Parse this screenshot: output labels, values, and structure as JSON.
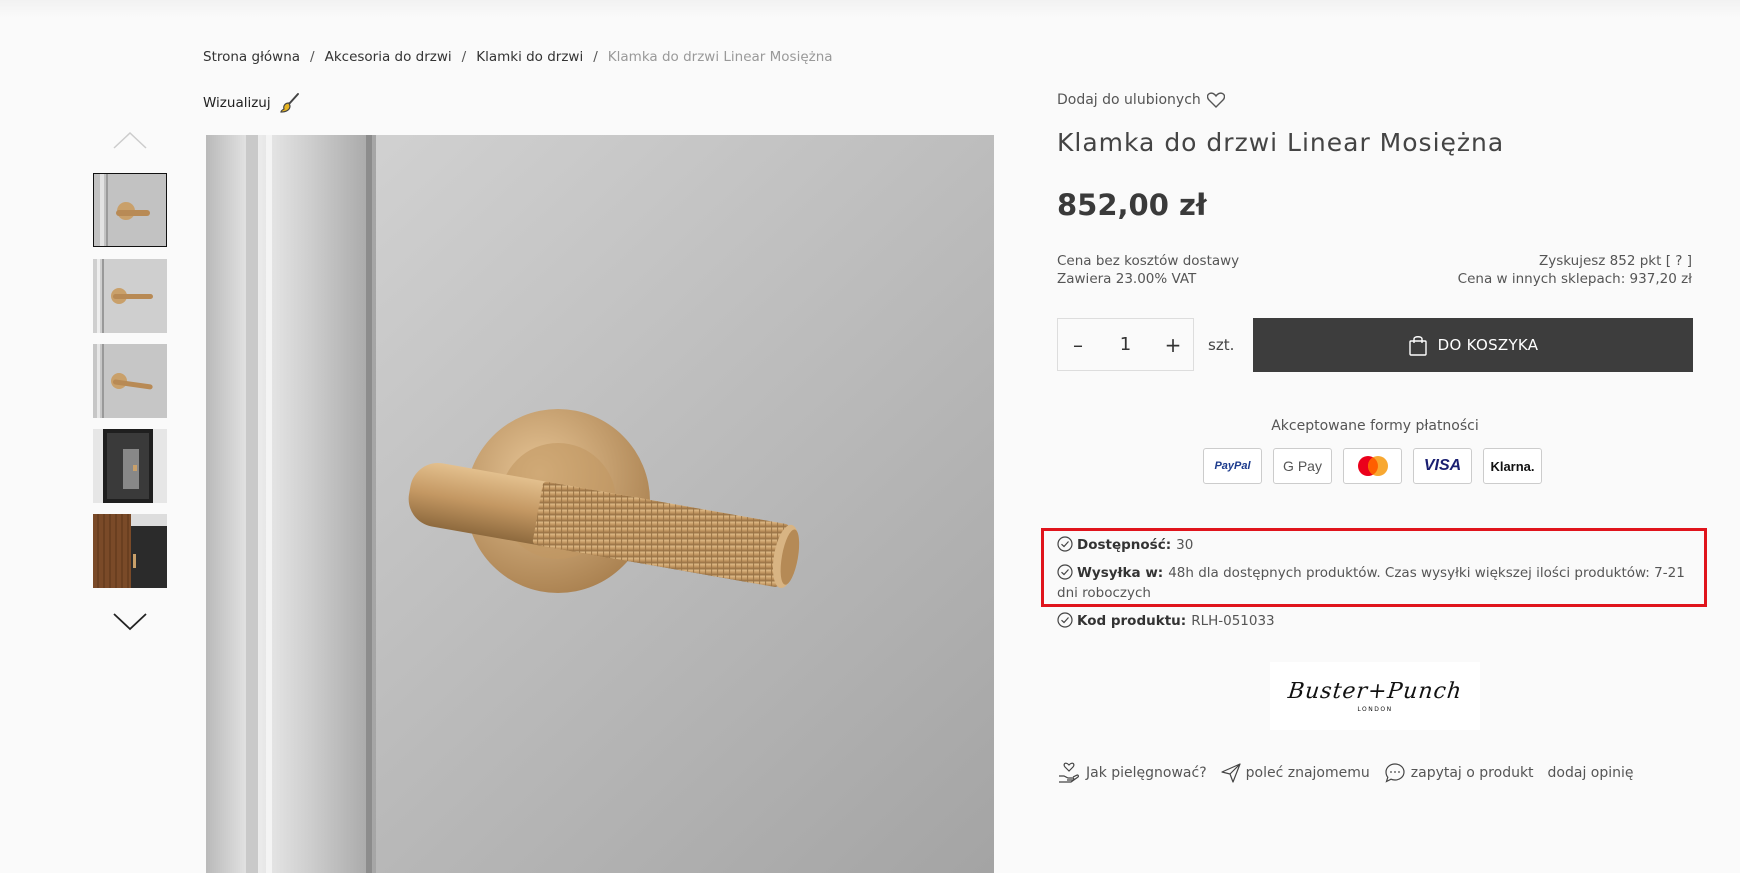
{
  "breadcrumb": {
    "items": [
      "Strona główna",
      "Akcesoria do drzwi",
      "Klamki do drzwi"
    ],
    "separator": "/",
    "current": "Klamka do drzwi Linear Mosiężna"
  },
  "visualize": {
    "label": "Wizualizuj",
    "icon": "paintbrush-icon"
  },
  "gallery": {
    "up_icon": "chevron-up-icon",
    "down_icon": "chevron-down-icon",
    "thumb_count": 5,
    "active_index": 0
  },
  "product": {
    "favorites_label": "Dodaj do ulubionych",
    "title": "Klamka do drzwi Linear Mosiężna",
    "price": "852,00 zł",
    "shipping_note": "Cena bez kosztów dostawy",
    "vat_note": "Zawiera 23.00% VAT",
    "points_label": "Zyskujesz 852 pkt",
    "points_help": "[ ? ]",
    "other_price_label": "Cena w innych sklepach:",
    "other_price_value": "937,20 zł"
  },
  "cart": {
    "minus": "–",
    "quantity": "1",
    "plus": "+",
    "unit": "szt.",
    "button_label": "DO KOSZYKA"
  },
  "payments": {
    "title": "Akceptowane formy płatności",
    "paypal": "PayPal",
    "googlepay": "G Pay",
    "visa": "VISA",
    "klarna": "Klarna."
  },
  "availability": {
    "label": "Dostępność:",
    "value": "30"
  },
  "shipping": {
    "label": "Wysyłka w:",
    "value": "48h dla dostępnych produktów. Czas wysyłki większej ilości produktów: 7-21 dni roboczych"
  },
  "code": {
    "label": "Kod produktu:",
    "value": "RLH-051033"
  },
  "brand": {
    "name": "Buster+Punch",
    "sub": "LONDON"
  },
  "actions": {
    "care": "Jak pielęgnować?",
    "recommend": "poleć znajomemu",
    "ask": "zapytaj o produkt",
    "review": "dodaj opinię"
  },
  "colors": {
    "highlight": "#e0141c",
    "button_bg": "#3d3d3d",
    "brass": "#c9a06a"
  }
}
